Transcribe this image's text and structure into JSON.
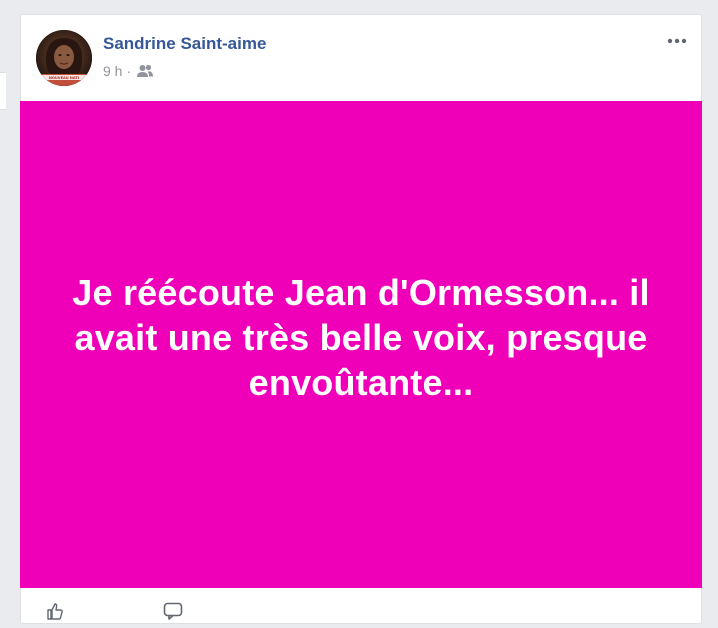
{
  "post": {
    "author_name": "Sandrine Saint-aime",
    "time": "9 h",
    "separator": "·",
    "audience_icon": "friends-icon",
    "more_icon": "ellipsis-icon",
    "avatar_caption": "NOUVEAU NATI",
    "body_text": "Je réécoute Jean d'Ormesson... il avait une très belle voix, presque envoûtante...",
    "background_color": "#ef00b8",
    "text_color": "#ffffff"
  },
  "actions": {
    "like_icon": "like-icon",
    "comment_icon": "comment-icon"
  },
  "colors": {
    "link_blue": "#365899",
    "meta_gray": "#90949c",
    "page_bg": "#e9ebee"
  }
}
